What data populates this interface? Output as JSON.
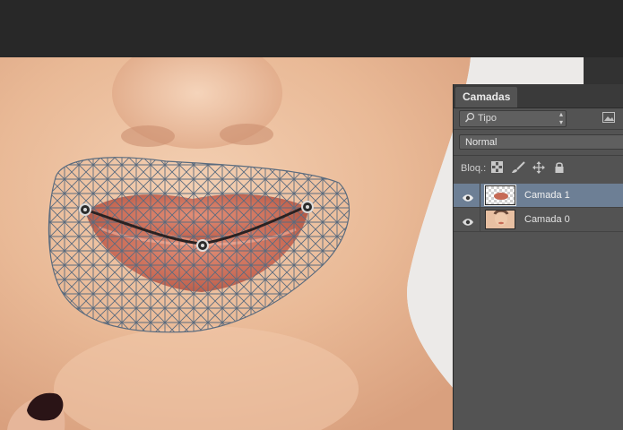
{
  "app": {
    "accent_selected_row": "#6d7f95",
    "panel_bg": "#535353"
  },
  "layers_panel": {
    "tab_label": "Camadas",
    "filter": {
      "value": "Tipo",
      "icon": "search-icon"
    },
    "blend_mode": "Normal",
    "lock_label": "Bloq.:",
    "lock_icons": [
      "lock-transparent-pixels-icon",
      "lock-image-pixels-icon",
      "lock-position-icon",
      "lock-all-icon"
    ],
    "layers": [
      {
        "name": "Camada 1",
        "visible": true,
        "selected": true
      },
      {
        "name": "Camada 0",
        "visible": true,
        "selected": false
      }
    ]
  },
  "canvas": {
    "tool": "puppet-warp",
    "pins": 3
  }
}
